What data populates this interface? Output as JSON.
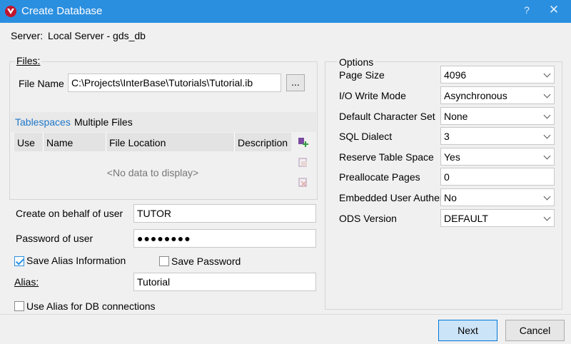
{
  "window": {
    "title": "Create Database",
    "help": "?",
    "close": "✕"
  },
  "server": {
    "label": "Server:",
    "value": "Local Server - gds_db"
  },
  "files": {
    "group_title": "Files:",
    "file_name_label": "File Name",
    "file_name_value": "C:\\Projects\\InterBase\\Tutorials\\Tutorial.ib",
    "browse_label": "...",
    "tabs": [
      "Tablespaces",
      "Multiple Files"
    ],
    "columns": [
      "Use",
      "Name",
      "File Location",
      "Description"
    ],
    "empty_text": "<No data to display>"
  },
  "user": {
    "create_on_behalf_label": "Create on behalf of user",
    "create_on_behalf_value": "TUTOR",
    "password_label": "Password of user",
    "password_value": "●●●●●●●●",
    "save_alias_label": "Save Alias Information",
    "save_password_label": "Save Password",
    "alias_label": "Alias:",
    "alias_value": "Tutorial",
    "use_alias_label": "Use Alias for DB connections"
  },
  "options": {
    "group_title": "Options",
    "rows": [
      {
        "label": "Page Size",
        "value": "4096",
        "kind": "combo"
      },
      {
        "label": "I/O Write Mode",
        "value": "Asynchronous",
        "kind": "combo"
      },
      {
        "label": "Default Character Set",
        "value": "None",
        "kind": "combo"
      },
      {
        "label": "SQL Dialect",
        "value": "3",
        "kind": "combo"
      },
      {
        "label": "Reserve Table Space",
        "value": "Yes",
        "kind": "combo"
      },
      {
        "label": "Preallocate Pages",
        "value": "0",
        "kind": "text"
      },
      {
        "label": "Embedded User Authen",
        "value": "No",
        "kind": "combo"
      },
      {
        "label": "ODS Version",
        "value": "DEFAULT",
        "kind": "combo"
      }
    ]
  },
  "buttons": {
    "next": "Next",
    "cancel": "Cancel"
  },
  "colors": {
    "titlebar": "#2b8fe0",
    "accent": "#0078d7",
    "tab_active": "#1f77c9"
  }
}
